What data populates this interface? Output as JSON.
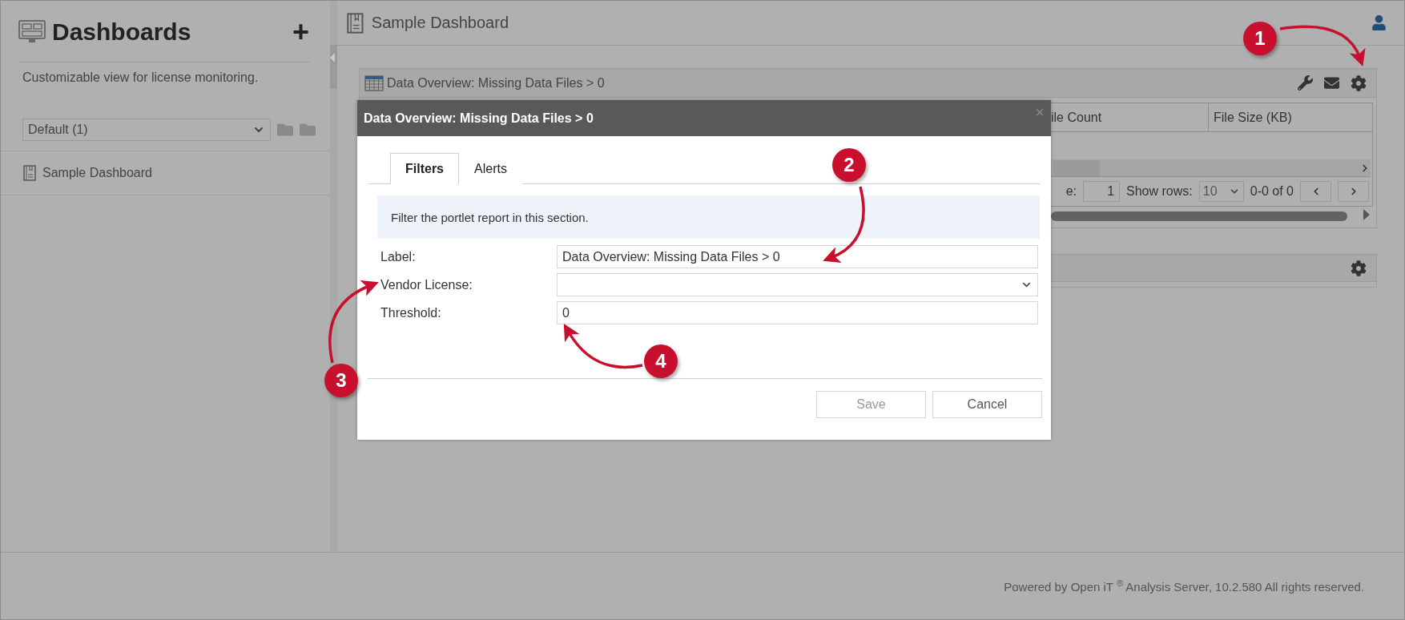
{
  "sidebar": {
    "title": "Dashboards",
    "add_button": "+",
    "description": "Customizable view for license monitoring.",
    "group_select": {
      "value": "Default (1)"
    },
    "items": [
      {
        "label": "Sample Dashboard"
      }
    ]
  },
  "header": {
    "title": "Sample Dashboard"
  },
  "portlet": {
    "title": "Data Overview: Missing Data Files > 0",
    "columns": [
      "ile Count",
      "File Size (KB)"
    ],
    "pager": {
      "label": "e:",
      "page": "1",
      "rows_label": "Show rows:",
      "rows": "10",
      "range": "0-0 of 0"
    }
  },
  "dialog": {
    "title": "Data Overview: Missing Data Files > 0",
    "close": "×",
    "tabs": [
      {
        "label": "Filters",
        "selected": true
      },
      {
        "label": "Alerts",
        "selected": false
      }
    ],
    "info": "Filter the portlet report in this section.",
    "fields": [
      {
        "label": "Label:",
        "kind": "text",
        "value": "Data Overview: Missing Data Files > 0"
      },
      {
        "label": "Vendor License:",
        "kind": "select"
      },
      {
        "label": "Threshold:",
        "kind": "text",
        "value": "0"
      }
    ],
    "buttons": [
      {
        "label": "Save",
        "disabled": true
      },
      {
        "label": "Cancel",
        "disabled": false
      }
    ]
  },
  "callouts": [
    "1",
    "2",
    "3",
    "4"
  ],
  "footer": {
    "text": "Powered by Open iT $^{®}$ Analysis Server, 10.2.580 All rights reserved."
  }
}
